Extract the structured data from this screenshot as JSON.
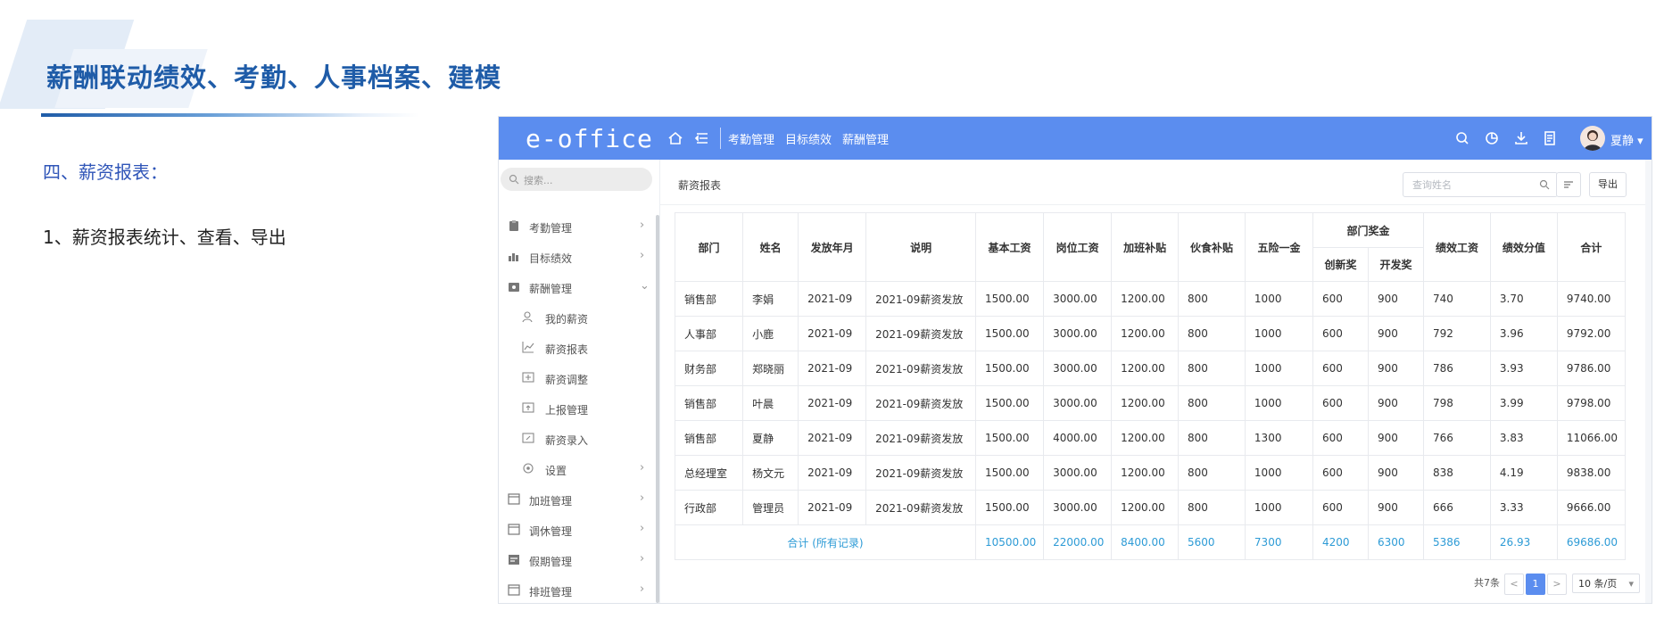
{
  "slide": {
    "title": "薪酬联动绩效、考勤、人事档案、建模",
    "section": "四、薪资报表：",
    "point": "1、薪资报表统计、查看、导出",
    "accent_color": "#1f5ca8"
  },
  "app": {
    "logo": "e-office",
    "header_color": "#5b8def",
    "nav": [
      "考勤管理",
      "目标绩效",
      "薪酬管理"
    ],
    "header_icons": [
      "home-icon",
      "menu-icon",
      "search-icon",
      "chart-pie-icon",
      "download-icon",
      "document-icon"
    ],
    "user_name": "夏静"
  },
  "sidebar": {
    "search_placeholder": "搜索...",
    "items": [
      {
        "label": "考勤管理",
        "icon": "clipboard-icon",
        "level": 1
      },
      {
        "label": "目标绩效",
        "icon": "bar-chart-icon",
        "level": 1
      },
      {
        "label": "薪酬管理",
        "icon": "wallet-icon",
        "level": 1,
        "expanded": true
      },
      {
        "label": "我的薪资",
        "icon": "person-icon",
        "level": 2
      },
      {
        "label": "薪资报表",
        "icon": "line-chart-icon",
        "level": 2
      },
      {
        "label": "薪资调整",
        "icon": "adjust-icon",
        "level": 2
      },
      {
        "label": "上报管理",
        "icon": "upload-icon",
        "level": 2
      },
      {
        "label": "薪资录入",
        "icon": "edit-icon",
        "level": 2
      },
      {
        "label": "设置",
        "icon": "settings-icon",
        "level": 2
      },
      {
        "label": "加班管理",
        "icon": "calendar-icon",
        "level": 1
      },
      {
        "label": "调休管理",
        "icon": "calendar-icon",
        "level": 1
      },
      {
        "label": "假期管理",
        "icon": "calendar-icon",
        "level": 1
      },
      {
        "label": "排班管理",
        "icon": "calendar-icon",
        "level": 1
      }
    ]
  },
  "report": {
    "title": "薪资报表",
    "search_placeholder": "查询姓名",
    "export_label": "导出",
    "headers": {
      "dept": "部门",
      "name": "姓名",
      "month": "发放年月",
      "note": "说明",
      "base": "基本工资",
      "post": "岗位工资",
      "overtime": "加班补贴",
      "meal": "伙食补贴",
      "insurance": "五险一金",
      "bonus_group": "部门奖金",
      "innovation": "创新奖",
      "development": "开发奖",
      "perf_pay": "绩效工资",
      "perf_score": "绩效分值",
      "total": "合计"
    },
    "rows": [
      [
        "销售部",
        "李娟",
        "2021-09",
        "2021-09薪资发放",
        "1500.00",
        "3000.00",
        "1200.00",
        "800",
        "1000",
        "600",
        "900",
        "740",
        "3.70",
        "9740.00"
      ],
      [
        "人事部",
        "小鹿",
        "2021-09",
        "2021-09薪资发放",
        "1500.00",
        "3000.00",
        "1200.00",
        "800",
        "1000",
        "600",
        "900",
        "792",
        "3.96",
        "9792.00"
      ],
      [
        "财务部",
        "郑晓丽",
        "2021-09",
        "2021-09薪资发放",
        "1500.00",
        "3000.00",
        "1200.00",
        "800",
        "1000",
        "600",
        "900",
        "786",
        "3.93",
        "9786.00"
      ],
      [
        "销售部",
        "叶晨",
        "2021-09",
        "2021-09薪资发放",
        "1500.00",
        "3000.00",
        "1200.00",
        "800",
        "1000",
        "600",
        "900",
        "798",
        "3.99",
        "9798.00"
      ],
      [
        "销售部",
        "夏静",
        "2021-09",
        "2021-09薪资发放",
        "1500.00",
        "4000.00",
        "1200.00",
        "800",
        "1300",
        "600",
        "900",
        "766",
        "3.83",
        "11066.00"
      ],
      [
        "总经理室",
        "杨文元",
        "2021-09",
        "2021-09薪资发放",
        "1500.00",
        "3000.00",
        "1200.00",
        "800",
        "1000",
        "600",
        "900",
        "838",
        "4.19",
        "9838.00"
      ],
      [
        "行政部",
        "管理员",
        "2021-09",
        "2021-09薪资发放",
        "1500.00",
        "3000.00",
        "1200.00",
        "800",
        "1000",
        "600",
        "900",
        "666",
        "3.33",
        "9666.00"
      ]
    ],
    "total_label": "合计 (所有记录)",
    "totals": [
      "10500.00",
      "22000.00",
      "8400.00",
      "5600",
      "7300",
      "4200",
      "6300",
      "5386",
      "26.93",
      "69686.00"
    ],
    "total_color": "#2d9bd6",
    "pagination": {
      "count_text": "共7条",
      "prev": "<",
      "current": "1",
      "next": ">",
      "page_size": "10 条/页"
    }
  }
}
